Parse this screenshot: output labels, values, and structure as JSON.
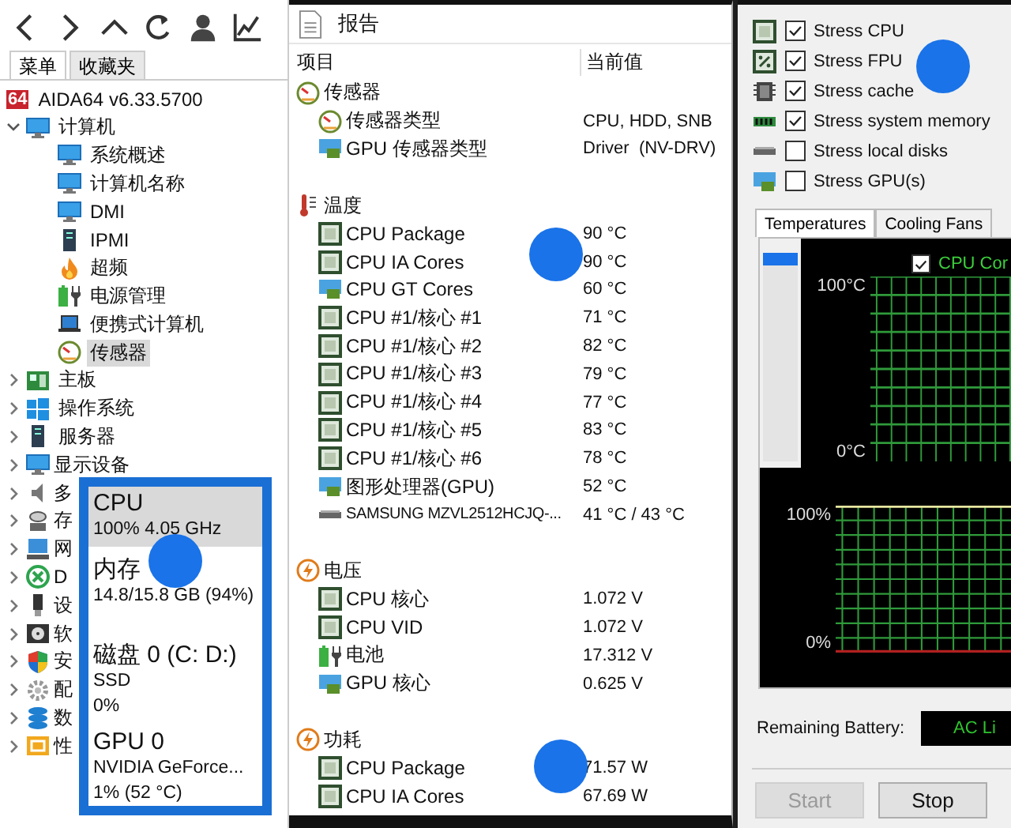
{
  "menu_tabs": [
    {
      "label": "菜单",
      "selected": true
    },
    {
      "label": "收藏夹",
      "selected": false
    }
  ],
  "tree": {
    "badge": "64",
    "label": "AIDA64 v6.33.5700",
    "children": [
      {
        "label": "计算机",
        "kind": "monitor",
        "expanded": true,
        "selected": false,
        "children": [
          {
            "label": "系统概述",
            "kind": "monitor",
            "selected": false
          },
          {
            "label": "计算机名称",
            "kind": "monitor",
            "selected": false
          },
          {
            "label": "DMI",
            "kind": "monitor",
            "selected": false
          },
          {
            "label": "IPMI",
            "kind": "server",
            "selected": false
          },
          {
            "label": "超频",
            "kind": "flame",
            "selected": false
          },
          {
            "label": "电源管理",
            "kind": "battery",
            "selected": false
          },
          {
            "label": "便携式计算机",
            "kind": "laptop",
            "selected": false
          },
          {
            "label": "传感器",
            "kind": "gauge",
            "selected": true
          }
        ]
      },
      {
        "label": "主板",
        "kind": "board",
        "expanded": false,
        "selected": false
      },
      {
        "label": "操作系统",
        "kind": "windows",
        "expanded": false,
        "selected": false
      },
      {
        "label": "服务器",
        "kind": "server",
        "expanded": false,
        "selected": false
      },
      {
        "label": "显示设备",
        "kind": "monitor",
        "expanded": false,
        "selected": false
      },
      {
        "label": "多",
        "kind": "speaker",
        "expanded": false,
        "selected": false
      },
      {
        "label": "存",
        "kind": "storage",
        "expanded": false,
        "selected": false
      },
      {
        "label": "网",
        "kind": "network",
        "expanded": false,
        "selected": false
      },
      {
        "label": "D",
        "kind": "xbox",
        "expanded": false,
        "selected": false
      },
      {
        "label": "设",
        "kind": "device",
        "expanded": false,
        "selected": false
      },
      {
        "label": "软",
        "kind": "software",
        "expanded": false,
        "selected": false
      },
      {
        "label": "安",
        "kind": "security",
        "expanded": false,
        "selected": false
      },
      {
        "label": "配",
        "kind": "config",
        "expanded": false,
        "selected": false
      },
      {
        "label": "数",
        "kind": "database",
        "expanded": false,
        "selected": false
      },
      {
        "label": "性",
        "kind": "perf",
        "expanded": false,
        "selected": false
      }
    ]
  },
  "performance_panel": [
    {
      "title": "CPU",
      "details": [
        "100% 4.05 GHz"
      ],
      "selected": true
    },
    {
      "title": "内存",
      "details": [
        "14.8/15.8 GB (94%)"
      ],
      "selected": false
    },
    {
      "title": "磁盘 0 (C: D:)",
      "details": [
        "SSD",
        "0%"
      ],
      "selected": false
    },
    {
      "title": "GPU 0",
      "details": [
        "NVIDIA GeForce...",
        "1% (52 °C)"
      ],
      "selected": false
    }
  ],
  "report": {
    "title": "报告",
    "columns": [
      "项目",
      "当前值"
    ],
    "sections": [
      {
        "label": "传感器",
        "kind": "gauge",
        "rows": [
          {
            "label": "传感器类型",
            "value": "CPU, HDD, SNB",
            "kind": "gauge"
          },
          {
            "label": "GPU 传感器类型",
            "value": "Driver  (NV-DRV)",
            "kind": "gpu"
          }
        ]
      },
      {
        "label": "温度",
        "kind": "thermo",
        "rows": [
          {
            "label": "CPU Package",
            "value": "90 °C",
            "kind": "chip"
          },
          {
            "label": "CPU IA Cores",
            "value": "90 °C",
            "kind": "chip"
          },
          {
            "label": "CPU GT Cores",
            "value": "60 °C",
            "kind": "gpu"
          },
          {
            "label": "CPU #1/核心 #1",
            "value": "71 °C",
            "kind": "chip"
          },
          {
            "label": "CPU #1/核心 #2",
            "value": "82 °C",
            "kind": "chip"
          },
          {
            "label": "CPU #1/核心 #3",
            "value": "79 °C",
            "kind": "chip"
          },
          {
            "label": "CPU #1/核心 #4",
            "value": "77 °C",
            "kind": "chip"
          },
          {
            "label": "CPU #1/核心 #5",
            "value": "83 °C",
            "kind": "chip"
          },
          {
            "label": "CPU #1/核心 #6",
            "value": "78 °C",
            "kind": "chip"
          },
          {
            "label": "图形处理器(GPU)",
            "value": "52 °C",
            "kind": "gpu"
          },
          {
            "label": "SAMSUNG MZVL2512HCJQ-...",
            "value": "41 °C / 43 °C",
            "kind": "drive"
          }
        ]
      },
      {
        "label": "电压",
        "kind": "bolt",
        "rows": [
          {
            "label": "CPU 核心",
            "value": "1.072 V",
            "kind": "chip"
          },
          {
            "label": "CPU VID",
            "value": "1.072 V",
            "kind": "chip"
          },
          {
            "label": "电池",
            "value": "17.312 V",
            "kind": "battery"
          },
          {
            "label": "GPU 核心",
            "value": "0.625 V",
            "kind": "gpu"
          }
        ]
      },
      {
        "label": "功耗",
        "kind": "bolt",
        "rows": [
          {
            "label": "CPU Package",
            "value": "71.57 W",
            "kind": "chip"
          },
          {
            "label": "CPU IA Cores",
            "value": "67.69 W",
            "kind": "chip"
          }
        ]
      }
    ]
  },
  "stress_options": [
    {
      "label": "Stress CPU",
      "checked": true,
      "kind": "chip"
    },
    {
      "label": "Stress FPU",
      "checked": true,
      "kind": "fpu"
    },
    {
      "label": "Stress cache",
      "checked": true,
      "kind": "cache"
    },
    {
      "label": "Stress system memory",
      "checked": true,
      "kind": "memory"
    },
    {
      "label": "Stress local disks",
      "checked": false,
      "kind": "drive"
    },
    {
      "label": "Stress GPU(s)",
      "checked": false,
      "kind": "gpu"
    }
  ],
  "graph_tabs": [
    {
      "label": "Temperatures",
      "selected": true
    },
    {
      "label": "Cooling Fans",
      "selected": false
    }
  ],
  "temperature_graph": {
    "legend": {
      "label": "CPU Cor",
      "checked": true
    },
    "top_label": "100°C",
    "bottom_label": "0°C"
  },
  "usage_graph": {
    "top_label": "100%",
    "bottom_label": "0%"
  },
  "battery": {
    "label": "Remaining Battery:",
    "value": "AC Li"
  },
  "buttons": [
    {
      "label": "Start",
      "disabled": true
    },
    {
      "label": "Stop",
      "disabled": false
    }
  ]
}
